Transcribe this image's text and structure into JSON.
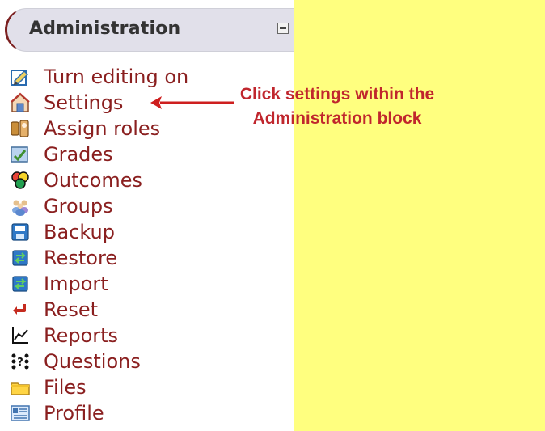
{
  "admin": {
    "title": "Administration"
  },
  "menu": {
    "items": [
      {
        "label": "Turn editing on",
        "icon": "edit-icon"
      },
      {
        "label": "Settings",
        "icon": "settings-icon"
      },
      {
        "label": "Assign roles",
        "icon": "roles-icon"
      },
      {
        "label": "Grades",
        "icon": "grades-icon"
      },
      {
        "label": "Outcomes",
        "icon": "outcomes-icon"
      },
      {
        "label": "Groups",
        "icon": "groups-icon"
      },
      {
        "label": "Backup",
        "icon": "backup-icon"
      },
      {
        "label": "Restore",
        "icon": "restore-icon"
      },
      {
        "label": "Import",
        "icon": "import-icon"
      },
      {
        "label": "Reset",
        "icon": "reset-icon"
      },
      {
        "label": "Reports",
        "icon": "reports-icon"
      },
      {
        "label": "Questions",
        "icon": "questions-icon"
      },
      {
        "label": "Files",
        "icon": "files-icon"
      },
      {
        "label": "Profile",
        "icon": "profile-icon"
      }
    ]
  },
  "callout": {
    "line1": "Click settings within the",
    "line2": "Administration block"
  },
  "colors": {
    "accent": "#8a1f1f",
    "callout": "#c0262d",
    "highlight": "#ffff7f",
    "header_bg": "#e1e0ea"
  }
}
